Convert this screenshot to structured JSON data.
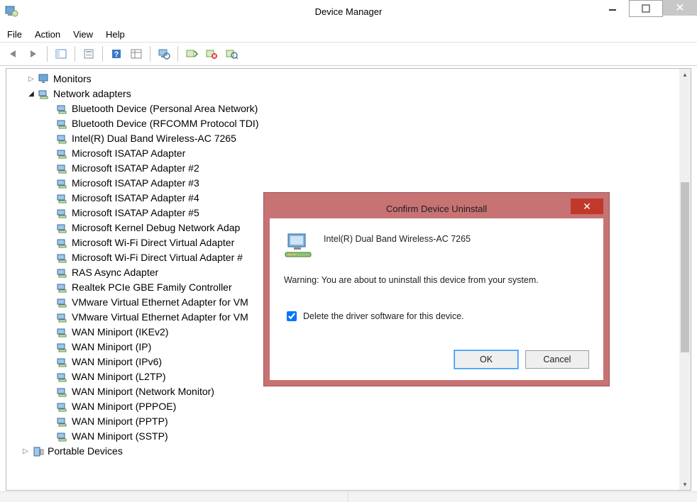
{
  "window": {
    "title": "Device Manager"
  },
  "menu": {
    "items": [
      "File",
      "Action",
      "View",
      "Help"
    ]
  },
  "toolbar": {
    "items": [
      "back",
      "forward",
      "sep",
      "show-hide-tree",
      "sep",
      "properties",
      "sep",
      "help",
      "action-grid",
      "sep",
      "computer-scan",
      "sep",
      "update-driver",
      "uninstall",
      "scan-hardware"
    ]
  },
  "tree": {
    "monitors": {
      "label": "Monitors",
      "expanded": false
    },
    "network_adapters": {
      "label": "Network adapters",
      "expanded": true,
      "children": [
        "Bluetooth Device (Personal Area Network)",
        "Bluetooth Device (RFCOMM Protocol TDI)",
        "Intel(R) Dual Band Wireless-AC 7265",
        "Microsoft ISATAP Adapter",
        "Microsoft ISATAP Adapter #2",
        "Microsoft ISATAP Adapter #3",
        "Microsoft ISATAP Adapter #4",
        "Microsoft ISATAP Adapter #5",
        "Microsoft Kernel Debug Network Adap",
        "Microsoft Wi-Fi Direct Virtual Adapter",
        "Microsoft Wi-Fi Direct Virtual Adapter #",
        "RAS Async Adapter",
        "Realtek PCIe GBE Family Controller",
        "VMware Virtual Ethernet Adapter for VM",
        "VMware Virtual Ethernet Adapter for VM",
        "WAN Miniport (IKEv2)",
        "WAN Miniport (IP)",
        "WAN Miniport (IPv6)",
        "WAN Miniport (L2TP)",
        "WAN Miniport (Network Monitor)",
        "WAN Miniport (PPPOE)",
        "WAN Miniport (PPTP)",
        "WAN Miniport (SSTP)"
      ]
    },
    "portable_devices": {
      "label": "Portable Devices",
      "expanded": false
    }
  },
  "dialog": {
    "title": "Confirm Device Uninstall",
    "device_name": "Intel(R) Dual Band Wireless-AC 7265",
    "warning_text": "Warning: You are about to uninstall this device from your system.",
    "checkbox_label": "Delete the driver software for this device.",
    "checkbox_checked": true,
    "ok_label": "OK",
    "cancel_label": "Cancel"
  }
}
